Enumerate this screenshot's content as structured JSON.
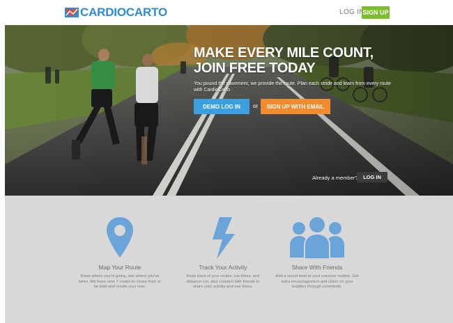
{
  "header": {
    "logo_text": "CARDIOCARTO",
    "login_label": "LOG IN",
    "signup_label": "SIGN UP"
  },
  "hero": {
    "title_line1": "MAKE EVERY MILE COUNT,",
    "title_line2": "JOIN FREE TODAY",
    "subtitle": "You pound the pavement, we provide the route. Plan each stride and learn from every route with CardioCarto",
    "demo_label": "DEMO LOG IN",
    "or_text": "or",
    "email_label": "SIGN UP WITH EMAIL",
    "member_text": "Already a member?",
    "login_label": "LOG IN"
  },
  "features": [
    {
      "icon": "map-pin-icon",
      "title": "Map Your Route",
      "desc": "Know where you're going, see where you've been. We have over 7 routes to chose from or be bold and create your own."
    },
    {
      "icon": "lightning-bolt-icon",
      "title": "Track Your Activity",
      "desc": "Keep track of your routes, run times, and distance run, also connect with friends to share your activity and see theirs."
    },
    {
      "icon": "people-group-icon",
      "title": "Share With Friends",
      "desc": "Add a social twist to your exercise routine. Get extra encouragement and cheer on your buddies through comments."
    }
  ],
  "colors": {
    "brand_blue": "#2f8ad0",
    "signup_green": "#7bbd2a",
    "demo_blue": "#3c9fe0",
    "email_orange": "#f28a2e",
    "feature_icon_blue": "#6aa4d8",
    "features_bg": "#d8d8d8"
  }
}
